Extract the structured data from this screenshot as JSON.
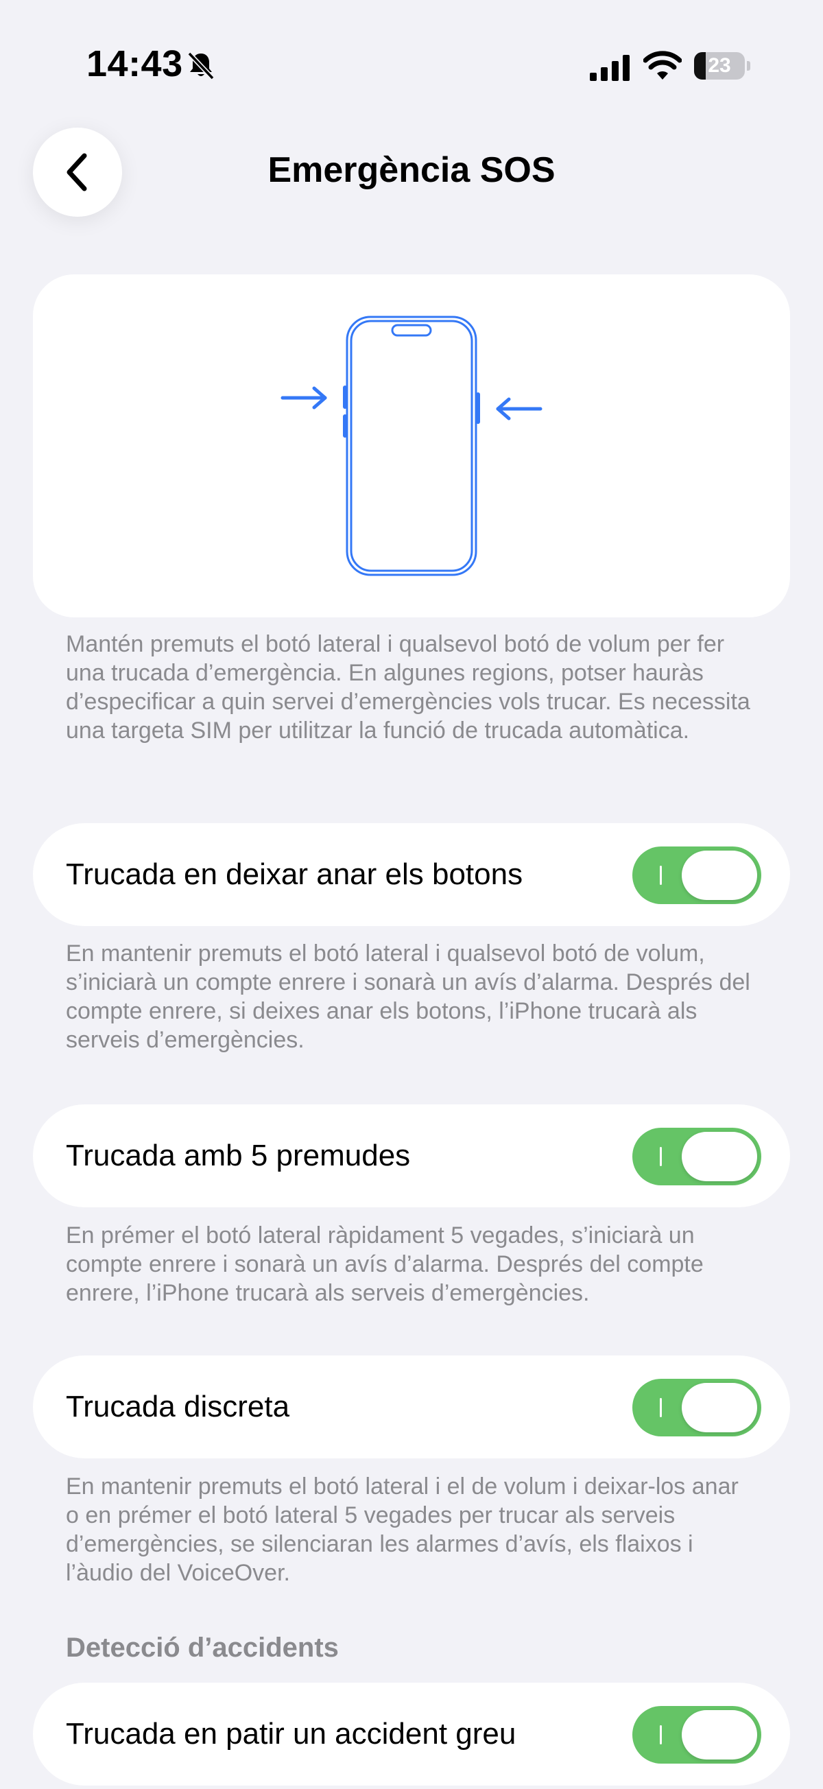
{
  "status_bar": {
    "time": "14:43",
    "battery_level": "23",
    "battery_fraction": 0.23
  },
  "nav": {
    "title": "Emergència SOS",
    "back_icon": "chevron-left-icon"
  },
  "illustration": {
    "description_text": "Mantén premuts el botó lateral i qualsevol botó de volum per fer una trucada d’emergència. En algunes regions, potser hauràs d’especificar a quin servei d’emergències vols trucar. Es necessita una targeta SIM per utilitzar la funció de trucada automàtica."
  },
  "settings": [
    {
      "label": "Trucada en deixar anar els botons",
      "enabled": true,
      "footer": "En mantenir premuts el botó lateral i qualsevol botó de volum, s’iniciarà un compte enrere i sonarà un avís d’alarma. Després del compte enrere, si deixes anar els botons, l’iPhone trucarà als serveis d’emergències."
    },
    {
      "label": "Trucada amb 5 premudes",
      "enabled": true,
      "footer": "En prémer el botó lateral ràpidament 5 vegades, s’iniciarà un compte enrere i sonarà un avís d’alarma. Després del compte enrere, l’iPhone trucarà als serveis d’emergències."
    },
    {
      "label": "Trucada discreta",
      "enabled": true,
      "footer": "En mantenir premuts el botó lateral i el de volum i deixar-los anar o en prémer el botó lateral 5 vegades per trucar als serveis d’emergències, se silenciaran les alarmes d’avís, els flaixos i l’àudio del VoiceOver."
    }
  ],
  "crash_detection": {
    "header": "Detecció d’accidents",
    "label": "Trucada en patir un accident greu",
    "enabled": true
  },
  "colors": {
    "accent_blue": "#3478f6",
    "toggle_on": "#65c466",
    "background": "#f2f2f7",
    "secondary_text": "#8a8a8e"
  }
}
